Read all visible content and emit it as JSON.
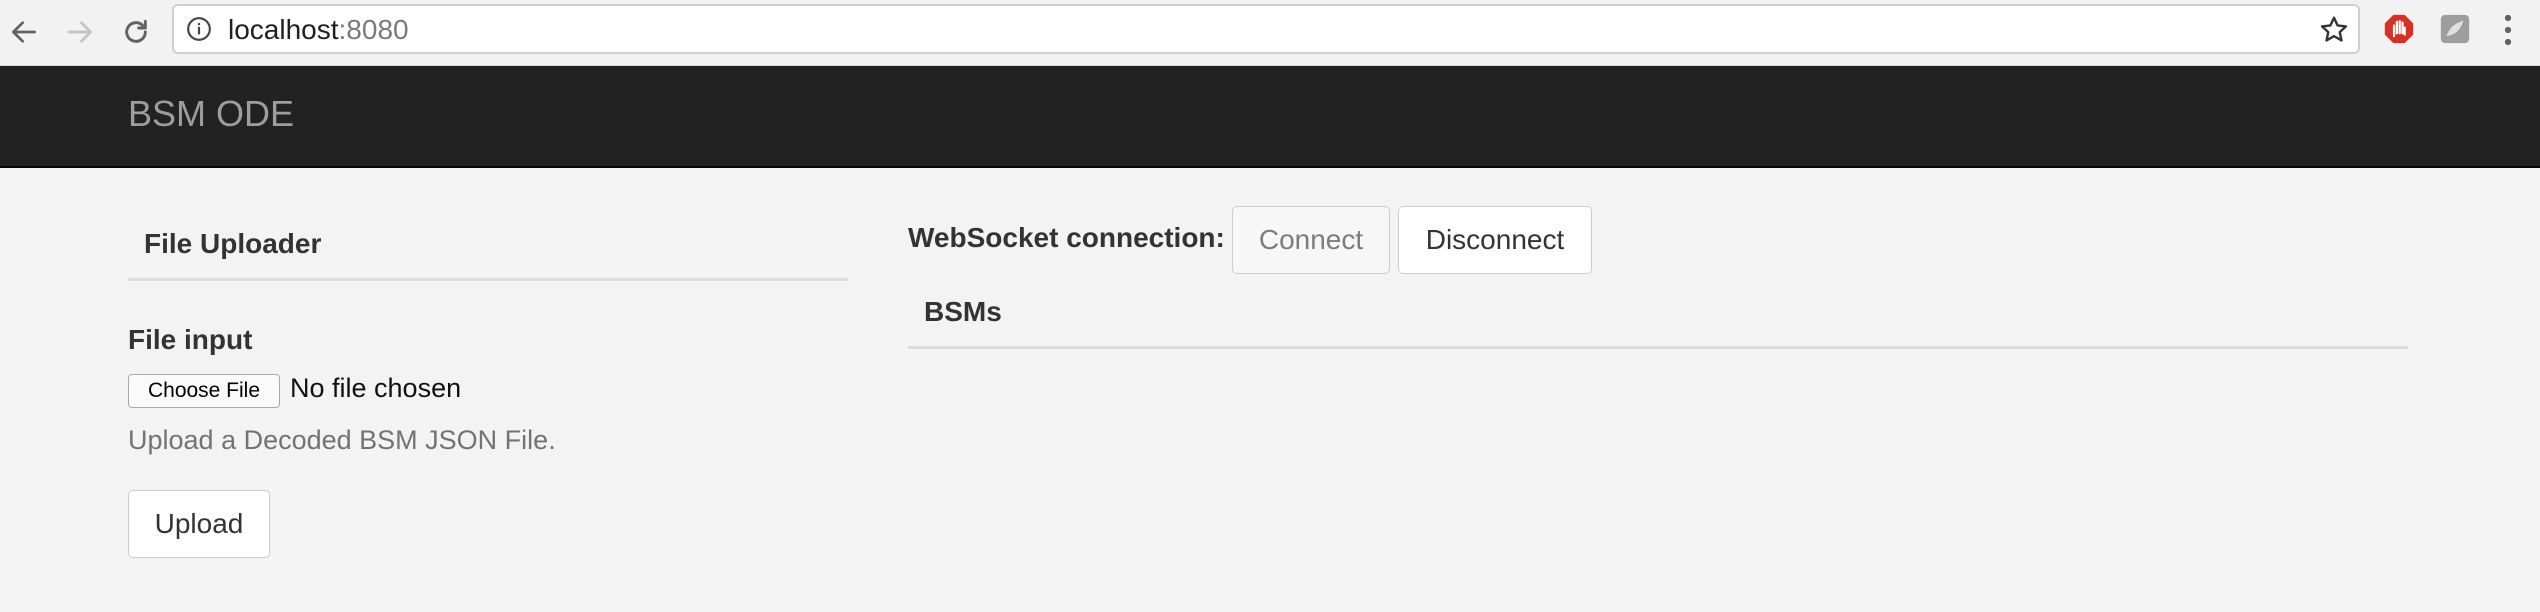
{
  "browser": {
    "url_host": "localhost",
    "url_port": ":8080",
    "icons": {
      "back": "arrow-left-icon",
      "forward": "arrow-right-icon",
      "reload": "reload-icon",
      "info": "info-icon",
      "bookmark": "star-icon",
      "extension_1": "stop-hand-icon",
      "extension_2": "extension-icon",
      "menu": "kebab-menu-icon"
    }
  },
  "navbar": {
    "brand": "BSM ODE"
  },
  "uploader": {
    "heading": "File Uploader",
    "field_label": "File input",
    "choose_button": "Choose File",
    "file_status": "No file chosen",
    "help_text": "Upload a Decoded BSM JSON File.",
    "upload_button": "Upload"
  },
  "websocket": {
    "label": "WebSocket connection:",
    "connect_button": "Connect",
    "disconnect_button": "Disconnect",
    "connect_disabled": true
  },
  "bsms": {
    "heading": "BSMs"
  },
  "colors": {
    "navbar_bg": "#222222",
    "brand_text": "#9d9d9d",
    "page_bg": "#f3f3f3",
    "extension_red": "#d93025"
  }
}
